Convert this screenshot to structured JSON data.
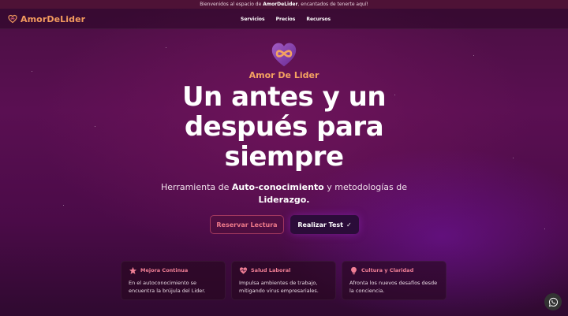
{
  "topbar": {
    "prefix": "Bienvenidos al espacio de ",
    "brand": "AmorDeLider",
    "suffix": ", encantados de tenerte aquí!"
  },
  "nav": {
    "brand": "AmorDeLider",
    "links": [
      "Servicios",
      "Precios",
      "Recursos"
    ]
  },
  "hero": {
    "brand_sub": "Amor De Lider",
    "headline": "Un antes y un después para siempre",
    "tagline_parts": [
      "Herramienta de ",
      "Auto-conocimiento",
      " y metodologías de ",
      "Liderazgo."
    ],
    "btn_reserve": "Reservar Lectura",
    "btn_test": "Realizar Test",
    "btn_test_check": "✓"
  },
  "cards": [
    {
      "icon": "star-icon",
      "title": "Mejora Continua",
      "text": "En el autoconocimiento se encuentra la brújula del Lider."
    },
    {
      "icon": "heart-pulse-icon",
      "title": "Salud Laboral",
      "text": "Impulsa ambientes de trabajo, mitigando virus empresariales."
    },
    {
      "icon": "lightbulb-icon",
      "title": "Cultura y Claridad",
      "text": "Afronta los nuevos desafíos desde la conciencia."
    }
  ],
  "colors": {
    "accent_orange": "#f29a5e",
    "accent_pink": "#f07f95",
    "primary_button": "#2b0c39",
    "background": "#4a0f42"
  }
}
